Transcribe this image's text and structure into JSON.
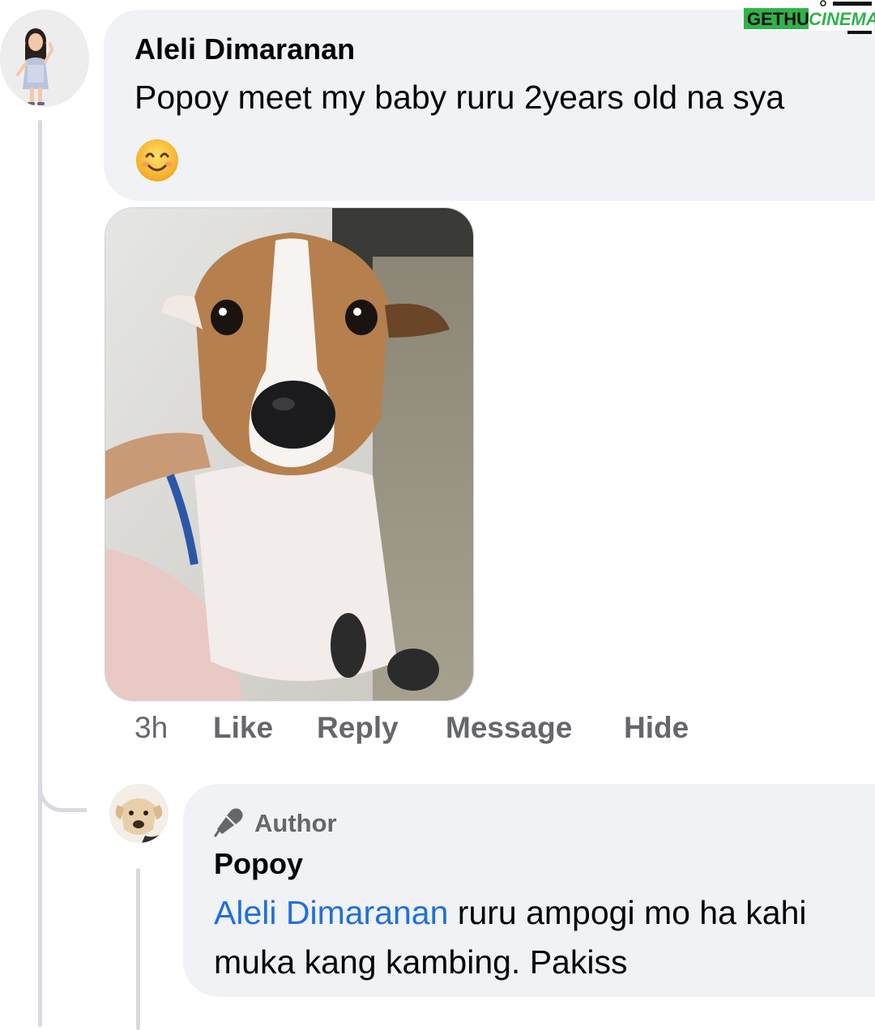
{
  "watermark": {
    "part1": "GETHU",
    "part2": "CINEMA"
  },
  "comment": {
    "author": "Aleli Dimaranan",
    "text_line1": "Popoy meet my baby ruru 2years old na sya",
    "emoji": "smiling-face-emoji",
    "photo_alt": "dog photo",
    "actions": {
      "time": "3h",
      "like": "Like",
      "reply": "Reply",
      "message": "Message",
      "hide": "Hide"
    }
  },
  "reply": {
    "badge": "Author",
    "author": "Popoy",
    "mention": "Aleli Dimaranan",
    "text_line1_rest": " ruru ampogi mo ha kahi",
    "text_line2": "muka kang kambing. Pakiss"
  },
  "colors": {
    "bubble": "#f0f2f5",
    "mention": "#216fdb",
    "secondary_text": "#65676b",
    "thread_line": "#d8dadf"
  }
}
